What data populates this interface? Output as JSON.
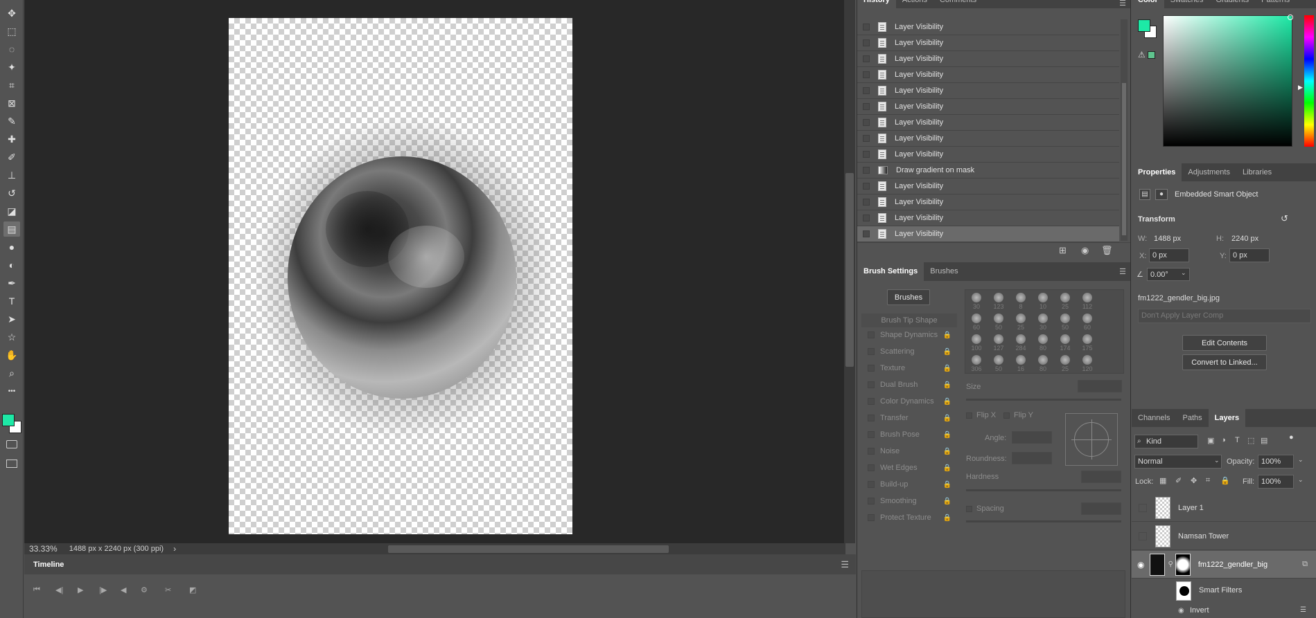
{
  "tools": [
    {
      "name": "move-tool-icon",
      "glyph": "✥"
    },
    {
      "name": "marquee-tool-icon",
      "glyph": "⬚"
    },
    {
      "name": "lasso-tool-icon",
      "glyph": "◌"
    },
    {
      "name": "magic-wand-tool-icon",
      "glyph": "✦"
    },
    {
      "name": "crop-tool-icon",
      "glyph": "⌗"
    },
    {
      "name": "frame-tool-icon",
      "glyph": "⊠"
    },
    {
      "name": "eyedropper-tool-icon",
      "glyph": "✎"
    },
    {
      "name": "healing-brush-tool-icon",
      "glyph": "✚"
    },
    {
      "name": "brush-tool-icon",
      "glyph": "✐"
    },
    {
      "name": "clone-stamp-tool-icon",
      "glyph": "⊥"
    },
    {
      "name": "history-brush-tool-icon",
      "glyph": "↺"
    },
    {
      "name": "eraser-tool-icon",
      "glyph": "◪"
    },
    {
      "name": "gradient-tool-icon",
      "glyph": "▤"
    },
    {
      "name": "blur-tool-icon",
      "glyph": "●"
    },
    {
      "name": "dodge-tool-icon",
      "glyph": "◐"
    },
    {
      "name": "pen-tool-icon",
      "glyph": "✒"
    },
    {
      "name": "type-tool-icon",
      "glyph": "T"
    },
    {
      "name": "path-selection-tool-icon",
      "glyph": "➤"
    },
    {
      "name": "shape-tool-icon",
      "glyph": "☆"
    },
    {
      "name": "hand-tool-icon",
      "glyph": "✋"
    },
    {
      "name": "zoom-tool-icon",
      "glyph": "⌕"
    },
    {
      "name": "more-tools-icon",
      "glyph": "•••"
    }
  ],
  "foreground_color": "#1de9a6",
  "background_color": "#ffffff",
  "status": {
    "zoom": "33.33%",
    "doc_info": "1488 px x 2240 px (300 ppi)",
    "arrow": "›"
  },
  "timeline": {
    "title": "Timeline"
  },
  "history": {
    "tabs": [
      "History",
      "Actions",
      "Comments"
    ],
    "rows": [
      {
        "label": "Layer Visibility",
        "type": "doc"
      },
      {
        "label": "Layer Visibility",
        "type": "doc"
      },
      {
        "label": "Layer Visibility",
        "type": "doc"
      },
      {
        "label": "Layer Visibility",
        "type": "doc"
      },
      {
        "label": "Layer Visibility",
        "type": "doc"
      },
      {
        "label": "Layer Visibility",
        "type": "doc"
      },
      {
        "label": "Layer Visibility",
        "type": "doc"
      },
      {
        "label": "Layer Visibility",
        "type": "doc"
      },
      {
        "label": "Layer Visibility",
        "type": "doc"
      },
      {
        "label": "Draw gradient on mask",
        "type": "grad"
      },
      {
        "label": "Layer Visibility",
        "type": "doc"
      },
      {
        "label": "Layer Visibility",
        "type": "doc"
      },
      {
        "label": "Layer Visibility",
        "type": "doc"
      },
      {
        "label": "Layer Visibility",
        "type": "doc"
      }
    ]
  },
  "brush_settings": {
    "tabs": [
      "Brush Settings",
      "Brushes"
    ],
    "brushes_button": "Brushes",
    "brush_tip_shape": "Brush Tip Shape",
    "options": [
      "Shape Dynamics",
      "Scattering",
      "Texture",
      "Dual Brush",
      "Color Dynamics",
      "Transfer",
      "Brush Pose",
      "Noise",
      "Wet Edges",
      "Build-up",
      "Smoothing",
      "Protect Texture"
    ],
    "brush_sizes": [
      "30",
      "123",
      "8",
      "10",
      "25",
      "112",
      "60",
      "50",
      "25",
      "30",
      "50",
      "60",
      "100",
      "127",
      "284",
      "80",
      "174",
      "175",
      "306",
      "50",
      "16",
      "80",
      "25",
      "120"
    ],
    "size_label": "Size",
    "flip_x": "Flip X",
    "flip_y": "Flip Y",
    "angle_label": "Angle:",
    "roundness_label": "Roundness:",
    "hardness_label": "Hardness",
    "spacing_label": "Spacing"
  },
  "color_panel": {
    "tabs": [
      "Color",
      "Swatches",
      "Gradients",
      "Patterns"
    ]
  },
  "properties": {
    "tabs": [
      "Properties",
      "Adjustments",
      "Libraries"
    ],
    "object_type": "Embedded Smart Object",
    "transform_label": "Transform",
    "w_label": "W:",
    "w_value": "1488 px",
    "h_label": "H:",
    "h_value": "2240 px",
    "x_label": "X:",
    "x_value": "0 px",
    "y_label": "Y:",
    "y_value": "0 px",
    "angle_value": "0.00°",
    "filename": "fm1222_gendler_big.jpg",
    "layer_comp_placeholder": "Don't Apply Layer Comp",
    "edit_contents": "Edit Contents",
    "convert_linked": "Convert to Linked..."
  },
  "layers": {
    "tabs": [
      "Channels",
      "Paths",
      "Layers"
    ],
    "kind_label": "Kind",
    "blend_mode": "Normal",
    "opacity_label": "Opacity:",
    "opacity_value": "100%",
    "lock_label": "Lock:",
    "fill_label": "Fill:",
    "fill_value": "100%",
    "items": [
      {
        "name": "Layer 1",
        "visible": false
      },
      {
        "name": "Namsan Tower",
        "visible": false
      },
      {
        "name": "fm1222_gendler_big",
        "visible": true,
        "selected": true
      }
    ],
    "smart_filters": "Smart Filters",
    "invert": "Invert"
  }
}
